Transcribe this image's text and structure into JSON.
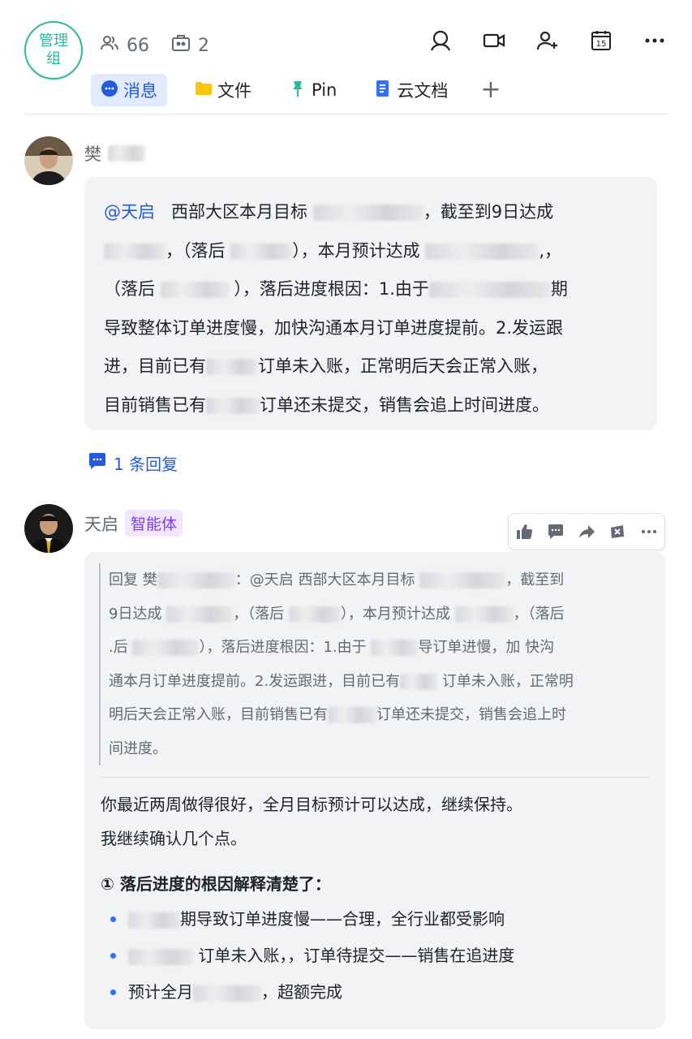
{
  "header": {
    "group_avatar_text": "管理组",
    "member_count": "66",
    "bot_count": "2",
    "icons": [
      "search-icon",
      "video-icon",
      "add-member-icon",
      "calendar-icon",
      "more-icon"
    ],
    "calendar_day": "15"
  },
  "tabs": [
    {
      "label": "消息",
      "icon": "message-icon",
      "active": true
    },
    {
      "label": "文件",
      "icon": "folder-icon"
    },
    {
      "label": "Pin",
      "icon": "pin-icon"
    },
    {
      "label": "云文档",
      "icon": "doc-icon"
    }
  ],
  "tab_add": "+",
  "message1": {
    "sender": "樊",
    "mention": "@天启",
    "lines": [
      [
        "西部大区本月目标",
        "，截至到9日达成"
      ],
      [
        "，（落后",
        "），本月预计达成",
        ",，"
      ],
      [
        "（落后",
        "），落后进度根因：1.由于",
        "期"
      ],
      [
        "导致整体订单进度慢，加快沟通本月订单进度提前。2.发运跟"
      ],
      [
        "进，目前已有",
        "订单未入账，正常明后天会正常入账，"
      ],
      [
        "目前销售已有",
        "订单还未提交，销售会追上时间进度。"
      ]
    ],
    "reply_count": "1 条回复"
  },
  "message2": {
    "sender": "天启",
    "badge": "智能体",
    "quote": {
      "prefix": "回复 樊",
      "lines": [
        [
          "：@天启  西部大区本月目标",
          "，截至到"
        ],
        [
          "9日达成",
          "，（落后",
          "），本月预计达成",
          "，（落后"
        ],
        [
          ".后",
          "），落后进度根因：1.由于",
          "导订单进慢，加 快沟"
        ],
        [
          "通本月订单进度提前。2.发运跟进，目前已有",
          "订单未入账，正常明"
        ],
        [
          "明后天会正常入账，目前销售已有",
          "订单还未提交，销售会追上时"
        ],
        [
          "间进度。"
        ]
      ]
    },
    "paragraph1": "你最近两周做得很好，全月目标预计可以达成，继续保持。",
    "paragraph2": "我继续确认几个点。",
    "heading": "① 落后进度的根因解释清楚了：",
    "bullets": [
      "期导致订单进度慢——合理，全行业都受影响",
      "订单未入账，，订单待提交——销售在追进度",
      [
        "预计全月",
        "，超额完成"
      ]
    ],
    "toolbar": [
      "thumbs-up-icon",
      "comment-icon",
      "forward-icon",
      "reaction-icon",
      "more-icon"
    ]
  },
  "colors": {
    "accent": "#245bdb",
    "group_green": "#2eb89a",
    "badge_purple": "#7f3bf5",
    "bubble_bg": "#f2f3f5"
  }
}
